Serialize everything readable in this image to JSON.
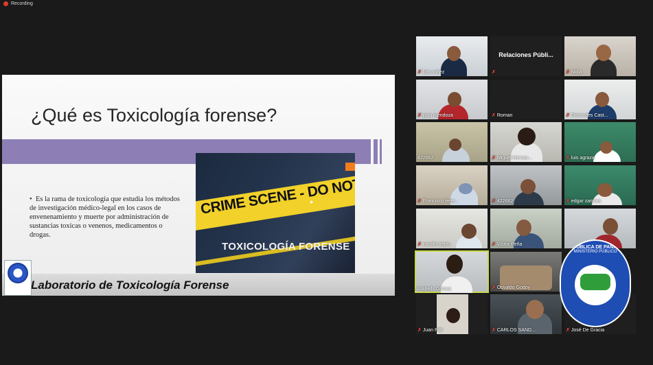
{
  "recording": {
    "label": "Recording"
  },
  "slide": {
    "title": "¿Qué es Toxicología forense?",
    "bullet": "Es la rama de toxicologia que estudia los métodos de investigación médico-legal en los casos de envenenamiento y muerte por administración de sustancias toxicas o venenos, medicamentos o drogas.",
    "image_tape_text": "CRIME SCENE - DO NOT ENT",
    "image_caption": "TOXICOLOGÍA FORENSE",
    "footer": "Laboratorio de Toxicología Forense",
    "logo_text": "REPUBLICA DE PANAMA MINISTERIO PUBLICO"
  },
  "participants": [
    {
      "name": "luis nuñez",
      "muted": true
    },
    {
      "name": "Relaciones Públi...",
      "muted": true,
      "video": false
    },
    {
      "name": "Nidia",
      "muted": true
    },
    {
      "name": "juan mendoza",
      "muted": true
    },
    {
      "name": "Roman",
      "muted": true,
      "video": false
    },
    {
      "name": "Diomedes Cast...",
      "muted": true
    },
    {
      "name": "422662",
      "muted": false
    },
    {
      "name": "Miguel Hernan...",
      "muted": true
    },
    {
      "name": "luis agraza",
      "muted": true
    },
    {
      "name": "Francisco ferer...",
      "muted": true
    },
    {
      "name": "422662",
      "muted": true
    },
    {
      "name": "edgar zamora",
      "muted": true
    },
    {
      "name": "rocolfo trejos",
      "muted": true
    },
    {
      "name": "Víctor Peña",
      "muted": true
    },
    {
      "name": "Anabells Gomez",
      "muted": false,
      "active": true
    },
    {
      "name": "Osvaldo Godoy",
      "muted": true
    },
    {
      "name": "Juan Pitti",
      "muted": true
    },
    {
      "name": "CARLOS SAND...",
      "muted": true
    },
    {
      "name": "José De Gracia",
      "muted": true
    }
  ],
  "emblem": {
    "line1": "REPÚBLICA DE PANAMÁ",
    "line2": "MINISTERIO PÚBLICO",
    "ring_text": "INSTITUTO DE MEDICINA LEGAL Y CIENCIAS FORENSES"
  }
}
